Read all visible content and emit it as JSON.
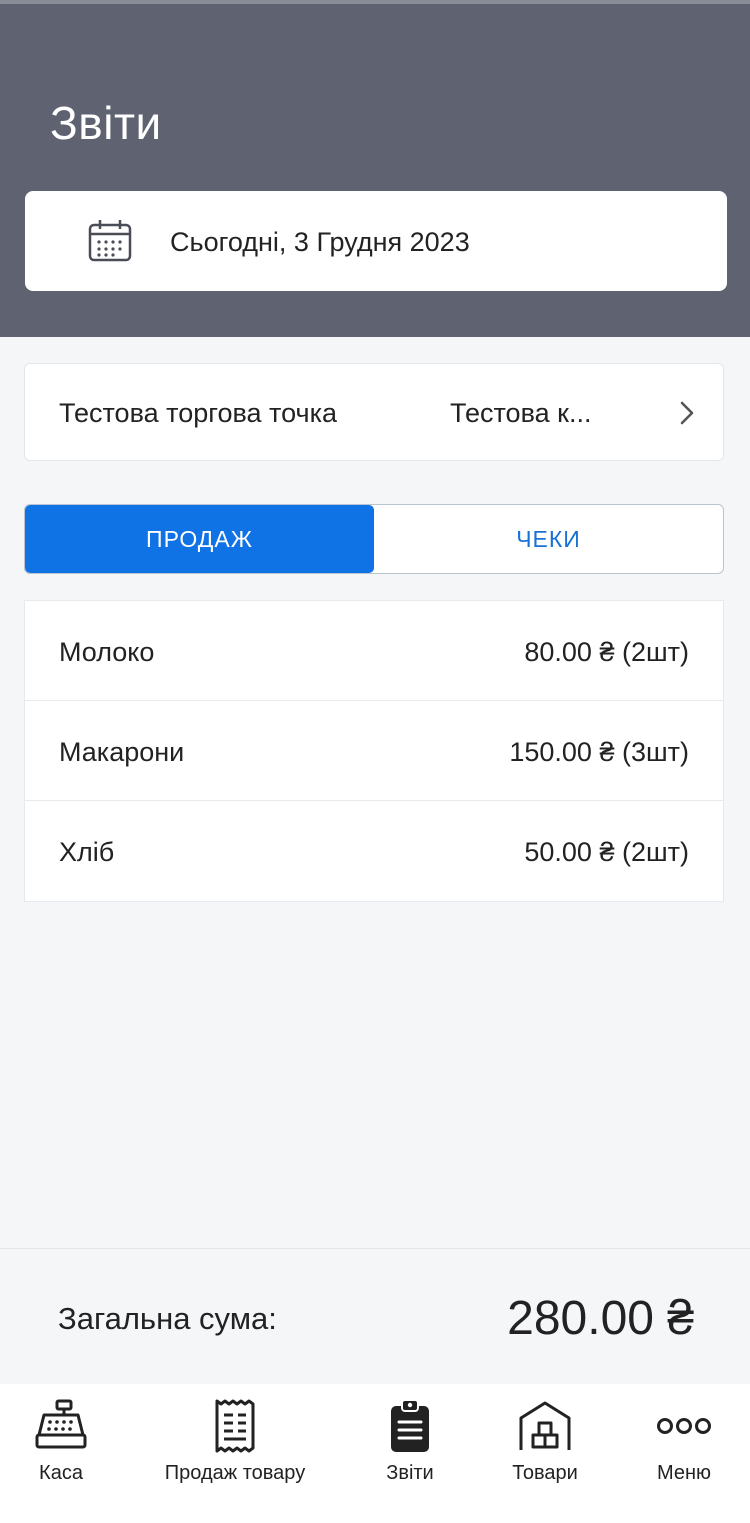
{
  "header": {
    "title": "Звіти",
    "date_label": "Сьогодні, 3 Грудня 2023"
  },
  "store": {
    "name": "Тестова торгова точка",
    "register": "Тестова к..."
  },
  "tabs": [
    {
      "label": "ПРОДАЖ",
      "active": true
    },
    {
      "label": "ЧЕКИ",
      "active": false
    }
  ],
  "sales": [
    {
      "name": "Молоко",
      "amount": "80.00 ₴ (2шт)"
    },
    {
      "name": "Макарони",
      "amount": "150.00 ₴ (3шт)"
    },
    {
      "name": "Хліб",
      "amount": "50.00 ₴ (2шт)"
    }
  ],
  "total": {
    "label": "Загальна сума:",
    "value": "280.00 ₴"
  },
  "nav": [
    {
      "label": "Каса",
      "icon": "cash-register-icon"
    },
    {
      "label": "Продаж товару",
      "icon": "receipt-icon"
    },
    {
      "label": "Звіти",
      "icon": "clipboard-icon"
    },
    {
      "label": "Товари",
      "icon": "warehouse-icon"
    },
    {
      "label": "Меню",
      "icon": "more-icon"
    }
  ],
  "colors": {
    "header_bg": "#5f6270",
    "accent": "#0f72e5",
    "tab_inactive_text": "#1a73d4"
  }
}
